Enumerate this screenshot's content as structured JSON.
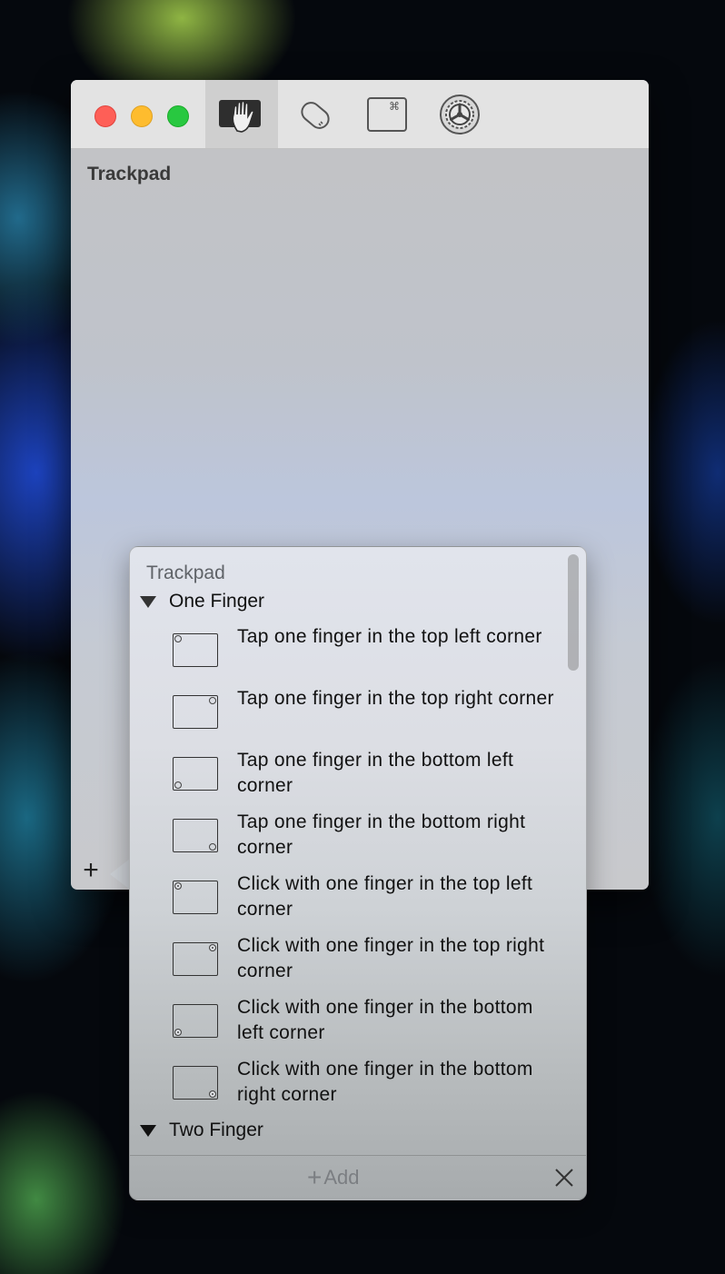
{
  "window": {
    "title": "Trackpad"
  },
  "toolbar": {
    "buttons": [
      {
        "name": "trackpad",
        "icon": "hand-trackpad-icon",
        "selected": true
      },
      {
        "name": "mouse",
        "icon": "mouse-icon",
        "selected": false
      },
      {
        "name": "keyboard",
        "icon": "command-key-icon",
        "selected": false
      },
      {
        "name": "preferences",
        "icon": "gear-icon",
        "selected": false
      }
    ]
  },
  "popover": {
    "header": "Trackpad",
    "groups": [
      {
        "label": "One Finger",
        "expanded": true,
        "items": [
          {
            "text": "Tap one finger in the top left corner",
            "corner": "top-left",
            "style": "tap"
          },
          {
            "text": "Tap one finger in the top right corner",
            "corner": "top-right",
            "style": "tap"
          },
          {
            "text": "Tap one finger in the bottom left corner",
            "corner": "bottom-left",
            "style": "tap"
          },
          {
            "text": "Tap one finger in the bottom right corner",
            "corner": "bottom-right",
            "style": "tap"
          },
          {
            "text": "Click with one finger in the top left corner",
            "corner": "top-left",
            "style": "click"
          },
          {
            "text": "Click with one finger in the top right corner",
            "corner": "top-right",
            "style": "click"
          },
          {
            "text": "Click with one finger in the bottom left corner",
            "corner": "bottom-left",
            "style": "click"
          },
          {
            "text": "Click with one finger in the bottom right corner",
            "corner": "bottom-right",
            "style": "click"
          }
        ]
      },
      {
        "label": "Two Finger",
        "expanded": true
      }
    ],
    "footer": {
      "add_label": "Add"
    }
  },
  "colors": {
    "close": "#fe5f57",
    "minimize": "#febc2e",
    "zoom": "#28c840"
  }
}
